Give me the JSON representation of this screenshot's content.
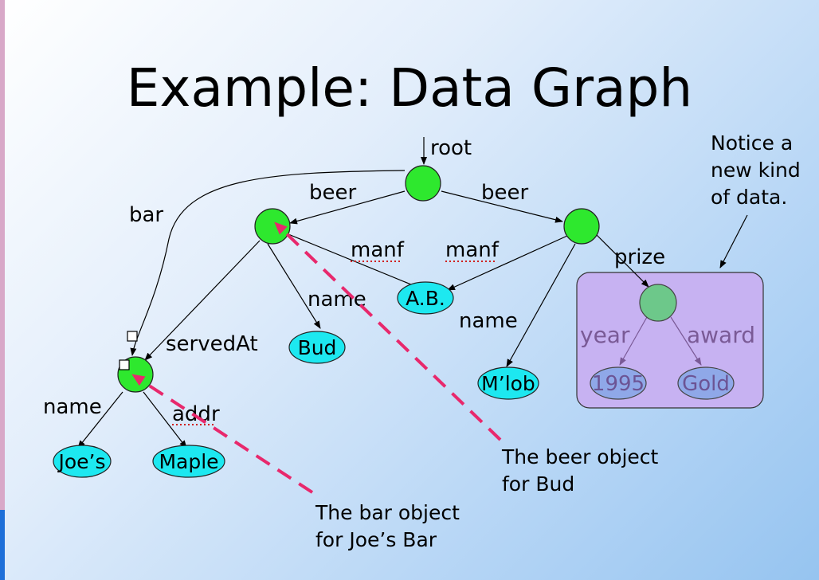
{
  "title": "Example: Data Graph",
  "edges": {
    "root": "root",
    "beer_left": "beer",
    "beer_right": "beer",
    "bar": "bar",
    "manf_left": "manf",
    "manf_right": "manf",
    "name_bud": "name",
    "name_mlob": "name",
    "served_at": "servedAt",
    "prize": "prize",
    "name_joes": "name",
    "addr": "addr",
    "year": "year",
    "award": "award"
  },
  "leaves": {
    "ab": "A.B.",
    "bud": "Bud",
    "mlob": "M’lob",
    "joes": "Joe’s",
    "maple": "Maple",
    "year_value": "1995",
    "award_value": "Gold"
  },
  "notes": {
    "new_kind_line1": "Notice a",
    "new_kind_line2": "new kind",
    "new_kind_line3": "of data.",
    "beer_obj_line1": "The beer object",
    "beer_obj_line2": "for Bud",
    "bar_obj_line1": "The bar object",
    "bar_obj_line2": "for Joe’s Bar"
  },
  "colors": {
    "node_green": "#2ee82e",
    "node_purple_fill": "#6dc88a",
    "leaf_cyan": "#1de8f0",
    "leaf_purple": "#8fa8e8",
    "box_purple": "#c7b2f2",
    "pointer_pink": "#e8286c",
    "underline_red": "#d02020"
  }
}
